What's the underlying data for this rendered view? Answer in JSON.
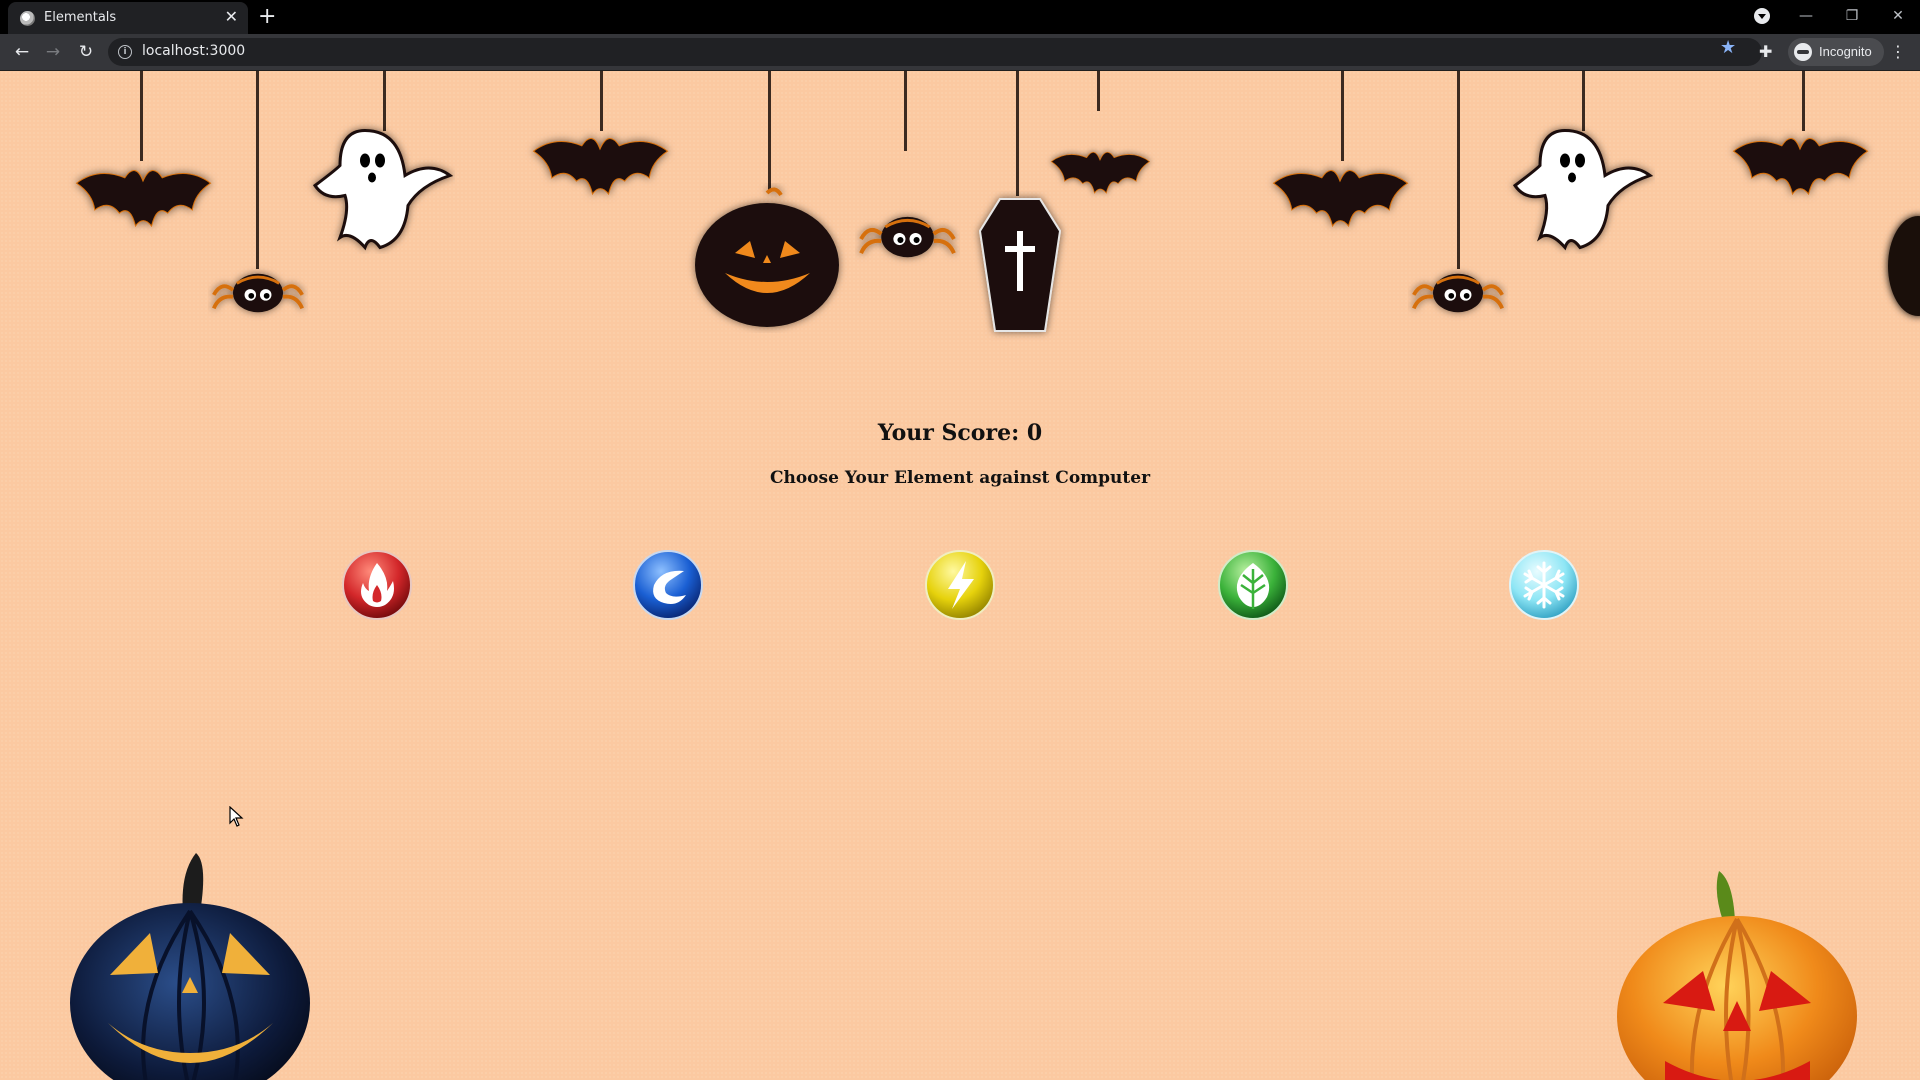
{
  "browser": {
    "tab_title": "Elementals",
    "tab_close": "✕",
    "new_tab": "+",
    "url": "localhost:3000",
    "profile_label": "Incognito",
    "back": "←",
    "forward": "→",
    "reload": "↻",
    "bookmark_star": "★",
    "extensions": "✚",
    "menu": "⋮",
    "minimize": "—",
    "restore": "❐",
    "close": "✕"
  },
  "game": {
    "score_text": "Your Score: 0",
    "instruction": "Choose Your Element against Computer",
    "elements": [
      {
        "name": "fire",
        "icon": "fire-icon",
        "color": "#d3272a"
      },
      {
        "name": "water",
        "icon": "water-icon",
        "color": "#1a5fd3"
      },
      {
        "name": "lightning",
        "icon": "lightning-icon",
        "color": "#e6d20c"
      },
      {
        "name": "nature",
        "icon": "leaf-icon",
        "color": "#3bb23a"
      },
      {
        "name": "ice",
        "icon": "snowflake-icon",
        "color": "#8ee6f5"
      }
    ]
  },
  "decorations": {
    "background_color": "#fbc9a1",
    "hanging_items": [
      "bat",
      "spider",
      "ghost",
      "bat",
      "jack-o-lantern",
      "spider",
      "coffin",
      "bat",
      "bat",
      "spider",
      "ghost",
      "bat"
    ],
    "ground_pumpkins": [
      "blue-jack-o-lantern",
      "orange-jack-o-lantern"
    ]
  }
}
